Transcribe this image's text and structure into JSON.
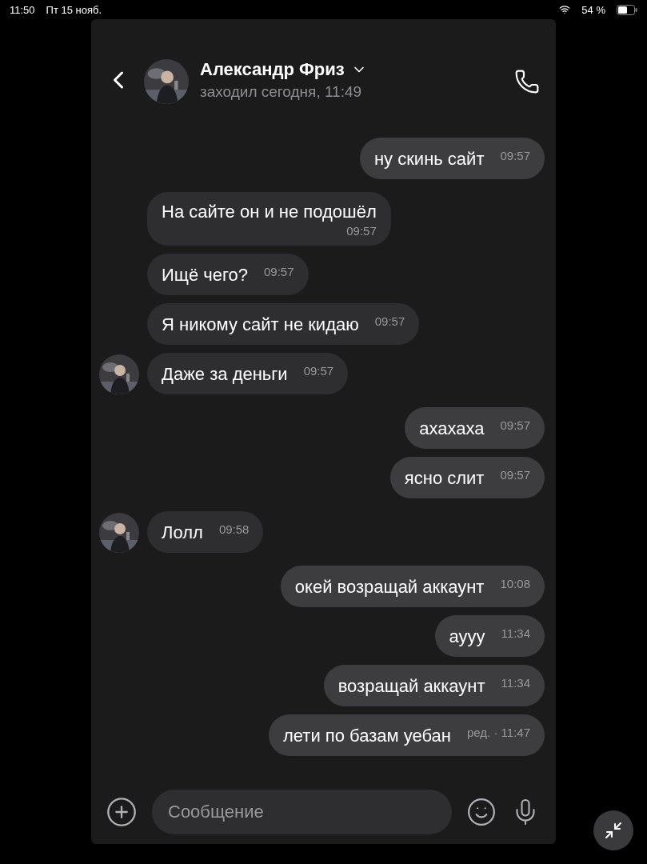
{
  "status_bar": {
    "time": "11:50",
    "date": "Пт 15 нояб.",
    "battery": "54 %"
  },
  "header": {
    "name": "Александр Фриз",
    "status": "заходил сегодня, 11:49"
  },
  "messages": [
    {
      "outgoing": true,
      "text": "ну скинь сайт",
      "time": "09:57"
    },
    {
      "outgoing": false,
      "text": "На сайте он и не подошёл",
      "time": "09:57",
      "time_below": true,
      "avatar": false
    },
    {
      "outgoing": false,
      "text": "Ищё чего?",
      "time": "09:57",
      "avatar": false
    },
    {
      "outgoing": false,
      "text": "Я никому сайт не кидаю",
      "time": "09:57",
      "avatar": false
    },
    {
      "outgoing": false,
      "text": "Даже за деньги",
      "time": "09:57",
      "avatar": true
    },
    {
      "outgoing": true,
      "text": "ахахаха",
      "time": "09:57"
    },
    {
      "outgoing": true,
      "text": "ясно слит",
      "time": "09:57"
    },
    {
      "outgoing": false,
      "text": "Лолл",
      "time": "09:58",
      "avatar": true
    },
    {
      "outgoing": true,
      "text": "окей возращай аккаунт",
      "time": "10:08"
    },
    {
      "outgoing": true,
      "text": "аууу",
      "time": "11:34"
    },
    {
      "outgoing": true,
      "text": "возращай аккаунт",
      "time": "11:34"
    },
    {
      "outgoing": true,
      "text": "лети по базам уебан",
      "time": "ред. · 11:47"
    }
  ],
  "composer": {
    "placeholder": "Сообщение"
  }
}
